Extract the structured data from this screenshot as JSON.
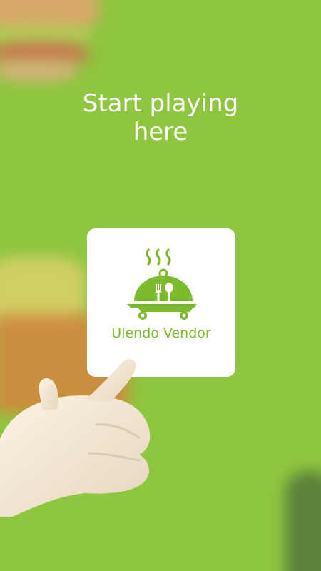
{
  "headline": {
    "line1": "Start playing",
    "line2": "here"
  },
  "app_card": {
    "name": "Ulendo Vendor",
    "logo_icon": "food-cloche-icon"
  },
  "colors": {
    "background": "#8fc63f",
    "accent": "#7cbb2e",
    "card": "#ffffff"
  }
}
